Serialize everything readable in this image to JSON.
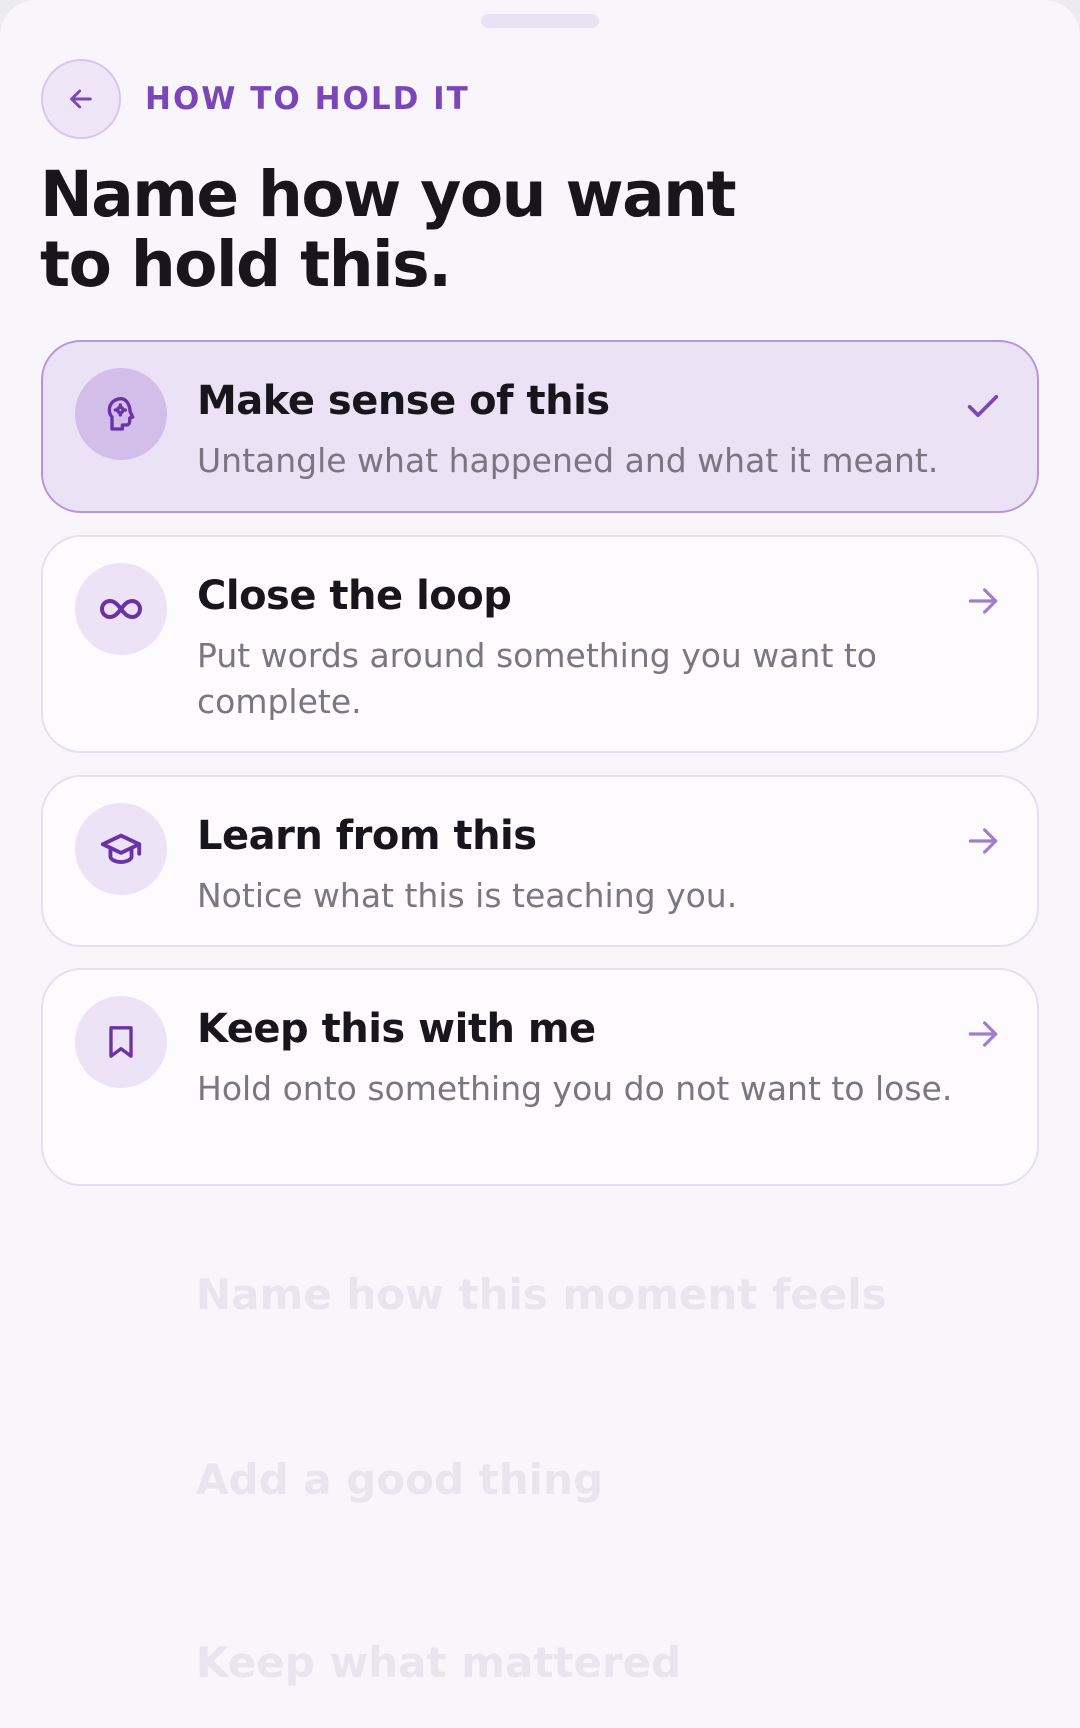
{
  "header": {
    "eyebrow": "HOW TO HOLD IT",
    "title": "Name how you want to hold this."
  },
  "options": [
    {
      "title": "Make sense of this",
      "description": "Untangle what happened and what it meant.",
      "icon": "head-gear-icon",
      "selected": true,
      "trailing": "check-icon"
    },
    {
      "title": "Close the loop",
      "description": "Put words around something you want to complete.",
      "icon": "infinity-icon",
      "selected": false,
      "trailing": "arrow-right-icon"
    },
    {
      "title": "Learn from this",
      "description": "Notice what this is teaching you.",
      "icon": "graduation-cap-icon",
      "selected": false,
      "trailing": "arrow-right-icon"
    },
    {
      "title": "Keep this with me",
      "description": "Hold onto something you do not want to lose.",
      "icon": "bookmark-icon",
      "selected": false,
      "trailing": "arrow-right-icon"
    }
  ],
  "background_items": [
    {
      "title": "Name how this moment feels"
    },
    {
      "title": "Add a good thing"
    },
    {
      "title": "Keep what mattered"
    }
  ],
  "colors": {
    "accent": "#7c46b8",
    "selected_background": "#ebe2f6",
    "selected_border": "#b895da",
    "text_primary": "#18161c",
    "text_secondary": "#7b7682"
  }
}
